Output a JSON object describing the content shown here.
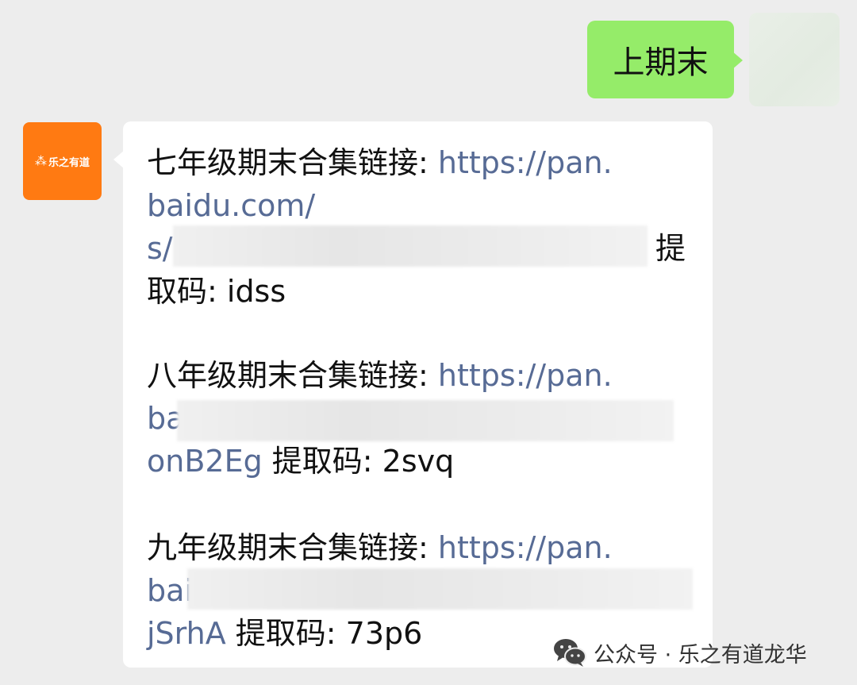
{
  "outgoing": {
    "text": "上期末"
  },
  "incoming": {
    "avatar_logo_text": "乐之有道",
    "avatar_logo_mark": "⁂",
    "lines": {
      "g7_label": "七年级期末合集链接: ",
      "g7_url_1": "https://pan.",
      "g7_url_2": "baidu.com/",
      "g7_url_3": "s/",
      "g7_code_tail_1": "提",
      "g7_code_tail_2": "取码: idss",
      "g8_label": "八年级期末合集链接: ",
      "g8_url_1": "https://pan.",
      "g8_url_2": "ba",
      "g8_url_3": "onB2Eg",
      "g8_code": " 提取码: 2svq",
      "g9_label": "九年级期末合集链接: ",
      "g9_url_1": "https://pan.",
      "g9_url_2": "bai",
      "g9_url_3": "jSrhA",
      "g9_code": " 提取码: 73p6"
    }
  },
  "watermark": {
    "icon": "wechat-icon",
    "text": "公众号 · 乐之有道龙华"
  },
  "colors": {
    "background": "#ededed",
    "outgoing_bubble": "#95ec69",
    "incoming_bubble": "#ffffff",
    "link": "#576b95",
    "avatar_orange": "#ff7a12"
  }
}
